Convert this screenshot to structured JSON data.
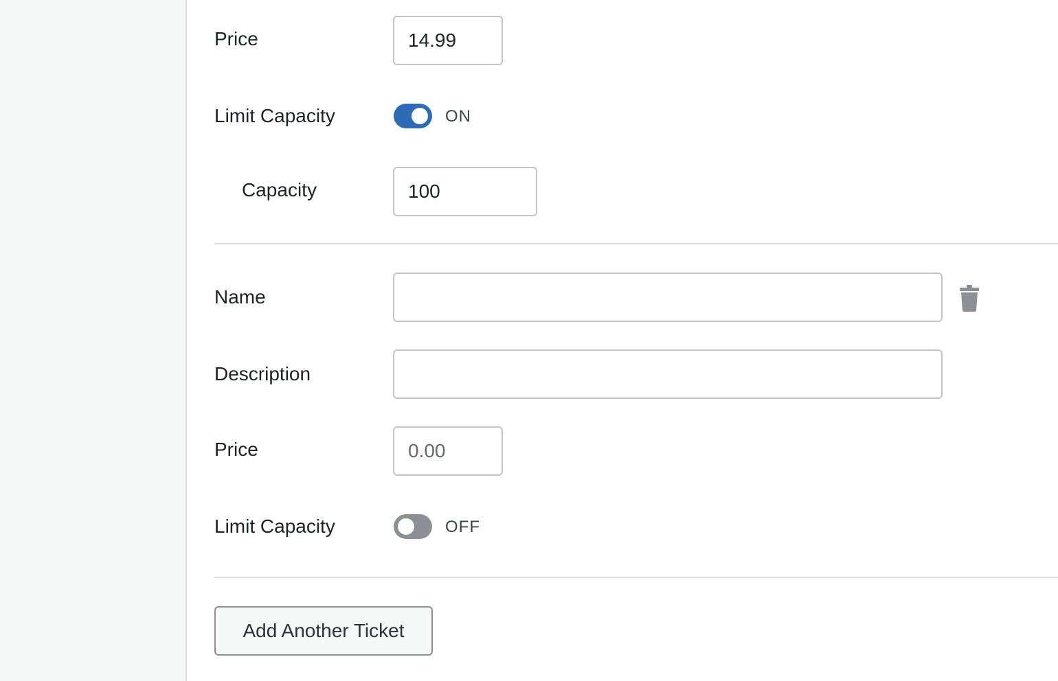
{
  "ticket1": {
    "price_label": "Price",
    "price_value": "14.99",
    "limit_label": "Limit Capacity",
    "limit_state": "ON",
    "limit_on": true,
    "capacity_label": "Capacity",
    "capacity_value": "100"
  },
  "ticket2": {
    "name_label": "Name",
    "name_value": "",
    "description_label": "Description",
    "description_value": "",
    "price_label": "Price",
    "price_placeholder": "0.00",
    "limit_label": "Limit Capacity",
    "limit_state": "OFF",
    "limit_on": false,
    "delete_icon": "trash-icon"
  },
  "actions": {
    "add_ticket_label": "Add Another Ticket"
  },
  "colors": {
    "toggle_on": "#2e6ab5",
    "toggle_off": "#8c8f94",
    "sidebar_bg": "#f6f7f7"
  }
}
